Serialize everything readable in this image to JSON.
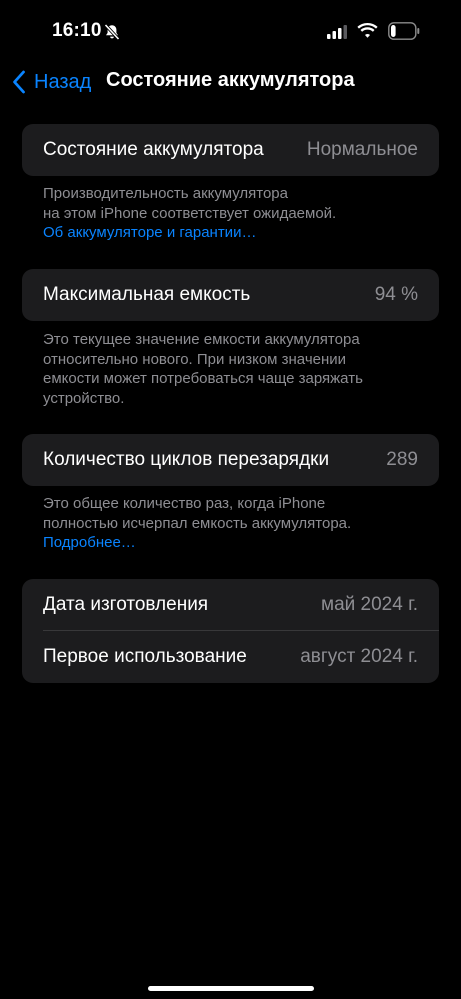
{
  "status_bar": {
    "time": "16:10",
    "battery_level": 0.2,
    "icons": [
      "bell-slash-icon",
      "cellular-signal-icon",
      "wifi-icon",
      "battery-icon"
    ]
  },
  "nav": {
    "back_label": "Назад",
    "title": "Состояние аккумулятора",
    "accent_color": "#0a84ff"
  },
  "battery_health": {
    "label": "Состояние аккумулятора",
    "value": "Нормальное",
    "footnote": "Производительность аккумулятора\nна этом iPhone соответствует ожидаемой.",
    "link": "Об аккумуляторе и гарантии…"
  },
  "max_capacity": {
    "label": "Максимальная емкость",
    "value": "94 %",
    "footnote": "Это текущее значение емкости аккумулятора\nотносительно нового. При низком значении\nемкости может потребоваться чаще заряжать\nустройство."
  },
  "cycle_count": {
    "label": "Количество циклов перезарядки",
    "value": "289",
    "footnote": "Это общее количество раз, когда iPhone\nполностью исчерпал емкость аккумулятора.",
    "link": "Подробнее…"
  },
  "dates": {
    "manufacture_label": "Дата изготовления",
    "manufacture_value": "май 2024 г.",
    "first_use_label": "Первое использование",
    "first_use_value": "август 2024 г."
  }
}
